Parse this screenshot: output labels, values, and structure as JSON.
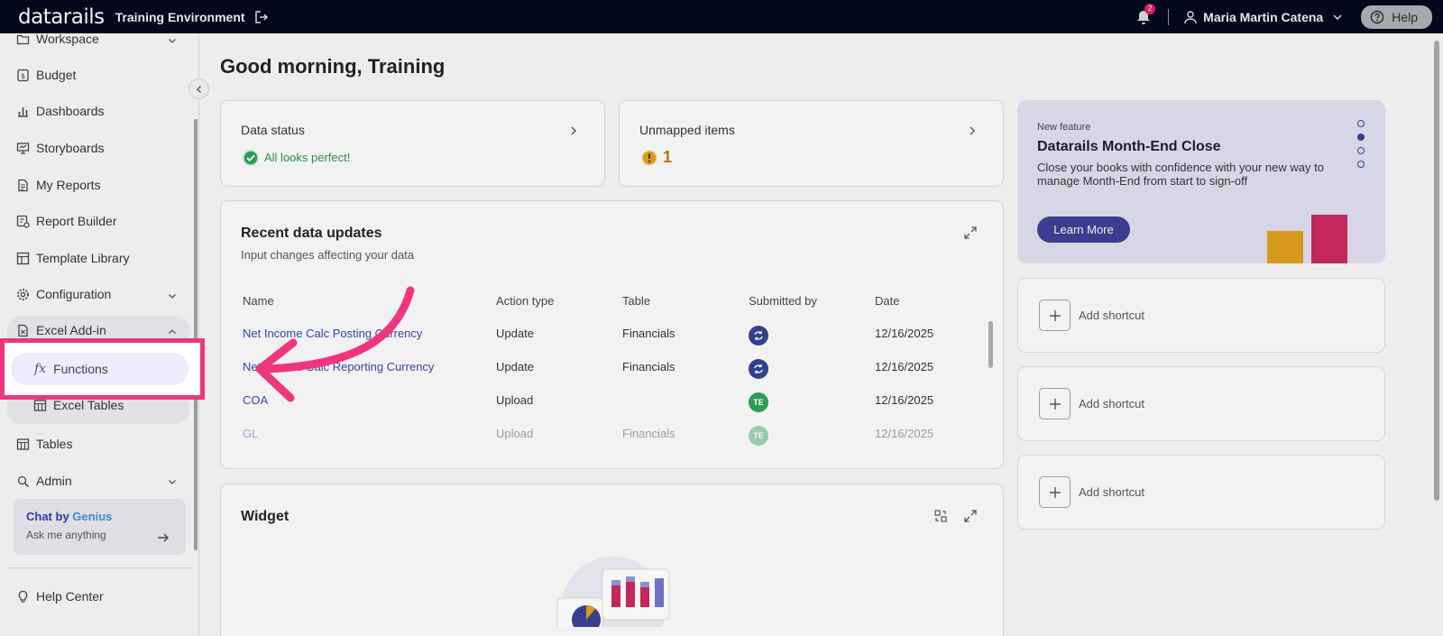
{
  "topbar": {
    "logo": "datarails",
    "environment": "Training Environment",
    "notification_count": "2",
    "user_name": "Maria Martin Catena",
    "help_label": "Help"
  },
  "sidebar": {
    "items": [
      {
        "label": "Workspace",
        "icon": "folder-icon"
      },
      {
        "label": "Budget",
        "icon": "dollar-doc-icon"
      },
      {
        "label": "Dashboards",
        "icon": "bar-chart-icon"
      },
      {
        "label": "Storyboards",
        "icon": "presentation-icon"
      },
      {
        "label": "My Reports",
        "icon": "report-icon"
      },
      {
        "label": "Report Builder",
        "icon": "report-builder-icon"
      },
      {
        "label": "Template Library",
        "icon": "template-icon"
      },
      {
        "label": "Configuration",
        "icon": "gear-icon"
      },
      {
        "label": "Excel Add-in",
        "icon": "excel-file-icon"
      },
      {
        "label": "Functions",
        "icon": "fx-icon"
      },
      {
        "label": "Excel Tables",
        "icon": "table-icon"
      },
      {
        "label": "Tables",
        "icon": "table-icon"
      },
      {
        "label": "Admin",
        "icon": "admin-icon"
      },
      {
        "label": "Help Center",
        "icon": "lightbulb-icon"
      }
    ],
    "chat": {
      "title_prefix": "Chat by",
      "title_brand": "Genius",
      "subtitle": "Ask me anything"
    },
    "fx_glyph": "fx"
  },
  "main": {
    "greeting": "Good morning, Training",
    "data_status": {
      "title": "Data status",
      "status": "All looks perfect!"
    },
    "unmapped": {
      "title": "Unmapped items",
      "count": "1"
    },
    "recent": {
      "title": "Recent data updates",
      "subtitle": "Input changes affecting your data",
      "columns": [
        "Name",
        "Action type",
        "Table",
        "Submitted by",
        "Date"
      ],
      "rows": [
        {
          "name": "Net Income Calc Posting Currency",
          "action": "Update",
          "table": "Financials",
          "submitted": "sync",
          "date": "12/16/2025"
        },
        {
          "name": "Net Income Calc Reporting Currency",
          "action": "Update",
          "table": "Financials",
          "submitted": "sync",
          "date": "12/16/2025"
        },
        {
          "name": "COA",
          "action": "Upload",
          "table": "",
          "submitted": "TE",
          "date": "12/16/2025"
        },
        {
          "name": "GL",
          "action": "Upload",
          "table": "Financials",
          "submitted": "TE",
          "date": "12/16/2025"
        }
      ]
    },
    "widget": {
      "title": "Widget"
    }
  },
  "promo": {
    "tag": "New feature",
    "title": "Datarails Month-End Close",
    "description": "Close your books with confidence with your new way to manage Month-End from start to sign-off",
    "button": "Learn More"
  },
  "shortcuts": [
    {
      "label": "Add shortcut"
    },
    {
      "label": "Add shortcut"
    },
    {
      "label": "Add shortcut"
    }
  ],
  "colors": {
    "accent": "#3a3e8c",
    "highlight": "#f0357f",
    "success": "#2e9c57",
    "warning": "#d89a1c"
  }
}
